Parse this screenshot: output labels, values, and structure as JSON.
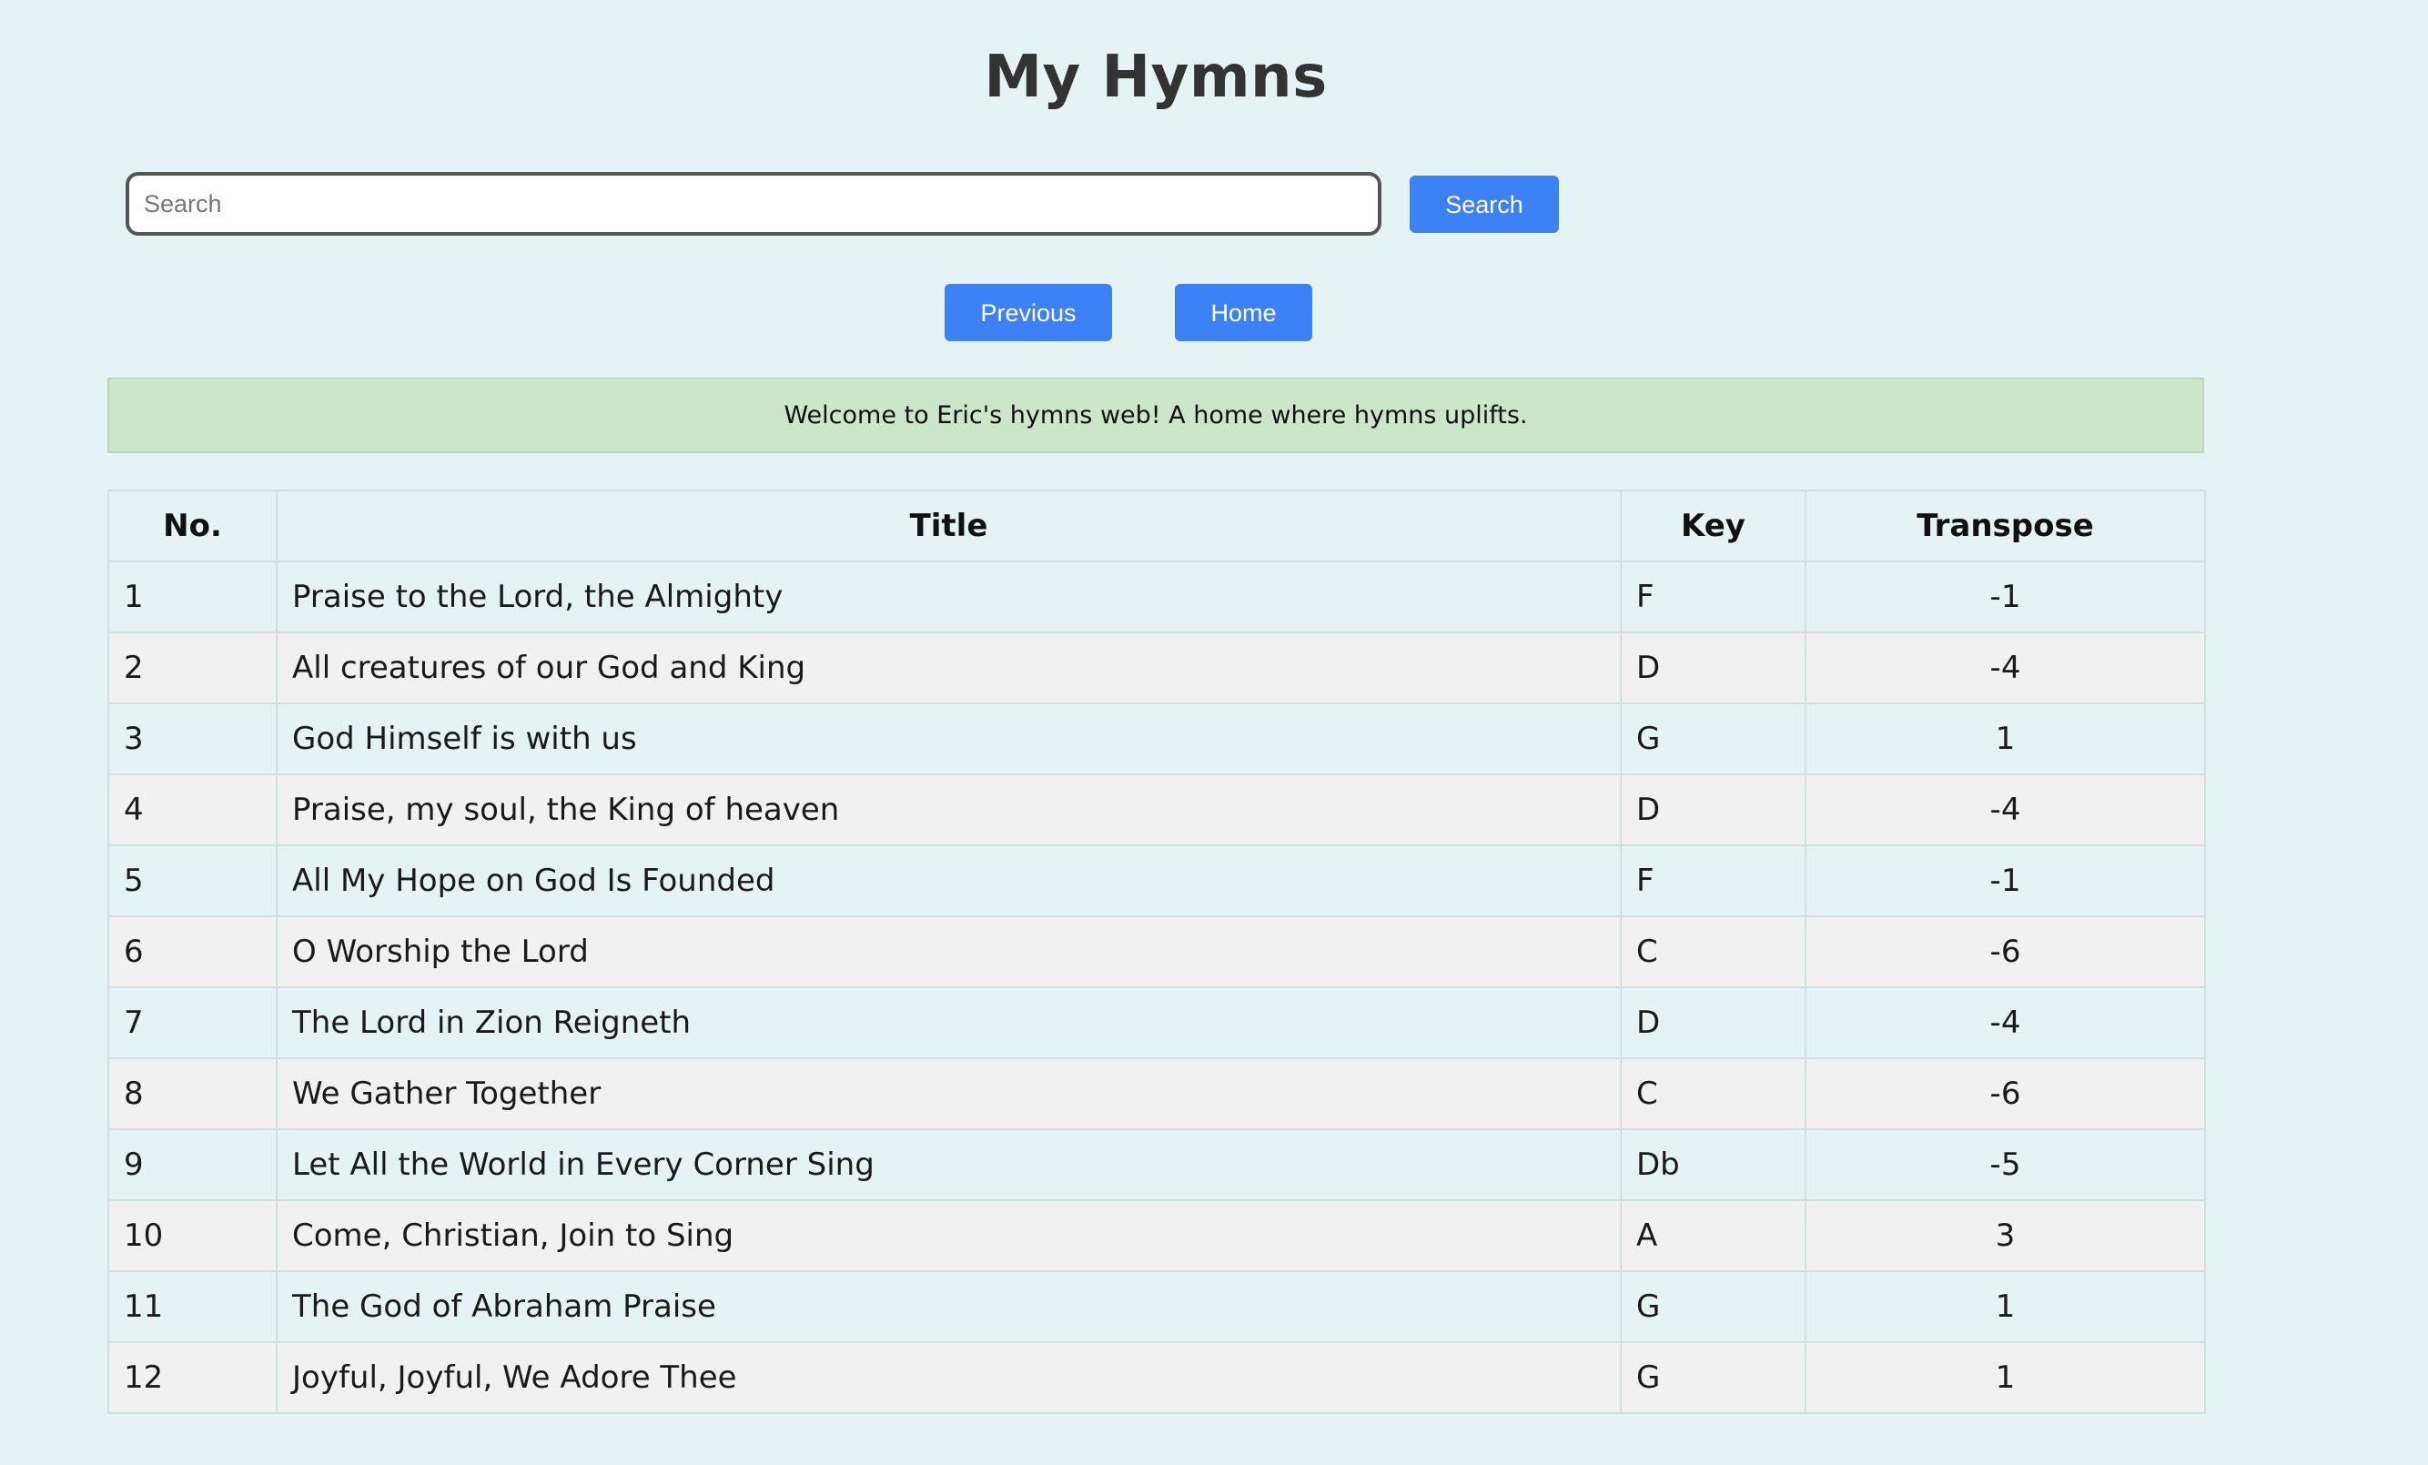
{
  "page": {
    "title": "My Hymns"
  },
  "search": {
    "placeholder": "Search",
    "value": "",
    "button_label": "Search"
  },
  "nav": {
    "previous_label": "Previous",
    "home_label": "Home"
  },
  "banner": {
    "text": "Welcome to Eric's hymns web! A home where hymns uplifts."
  },
  "table": {
    "headers": {
      "no": "No.",
      "title": "Title",
      "key": "Key",
      "transpose": "Transpose"
    },
    "rows": [
      {
        "no": "1",
        "title": "Praise to the Lord, the Almighty",
        "key": "F",
        "transpose": "-1"
      },
      {
        "no": "2",
        "title": "All creatures of our God and King",
        "key": "D",
        "transpose": "-4"
      },
      {
        "no": "3",
        "title": "God Himself is with us",
        "key": "G",
        "transpose": "1"
      },
      {
        "no": "4",
        "title": "Praise, my soul, the King of heaven",
        "key": "D",
        "transpose": "-4"
      },
      {
        "no": "5",
        "title": "All My Hope on God Is Founded",
        "key": "F",
        "transpose": "-1"
      },
      {
        "no": "6",
        "title": "O Worship the Lord",
        "key": "C",
        "transpose": "-6"
      },
      {
        "no": "7",
        "title": "The Lord in Zion Reigneth",
        "key": "D",
        "transpose": "-4"
      },
      {
        "no": "8",
        "title": "We Gather Together",
        "key": "C",
        "transpose": "-6"
      },
      {
        "no": "9",
        "title": "Let All the World in Every Corner Sing",
        "key": "Db",
        "transpose": "-5"
      },
      {
        "no": "10",
        "title": "Come, Christian, Join to Sing",
        "key": "A",
        "transpose": "3"
      },
      {
        "no": "11",
        "title": "The God of Abraham Praise",
        "key": "G",
        "transpose": "1"
      },
      {
        "no": "12",
        "title": "Joyful, Joyful, We Adore Thee",
        "key": "G",
        "transpose": "1"
      }
    ]
  },
  "colors": {
    "background": "#e5f3f5",
    "accent": "#3c82f6",
    "banner": "#cbe6c8",
    "row_alt": "#f1f1f1"
  }
}
